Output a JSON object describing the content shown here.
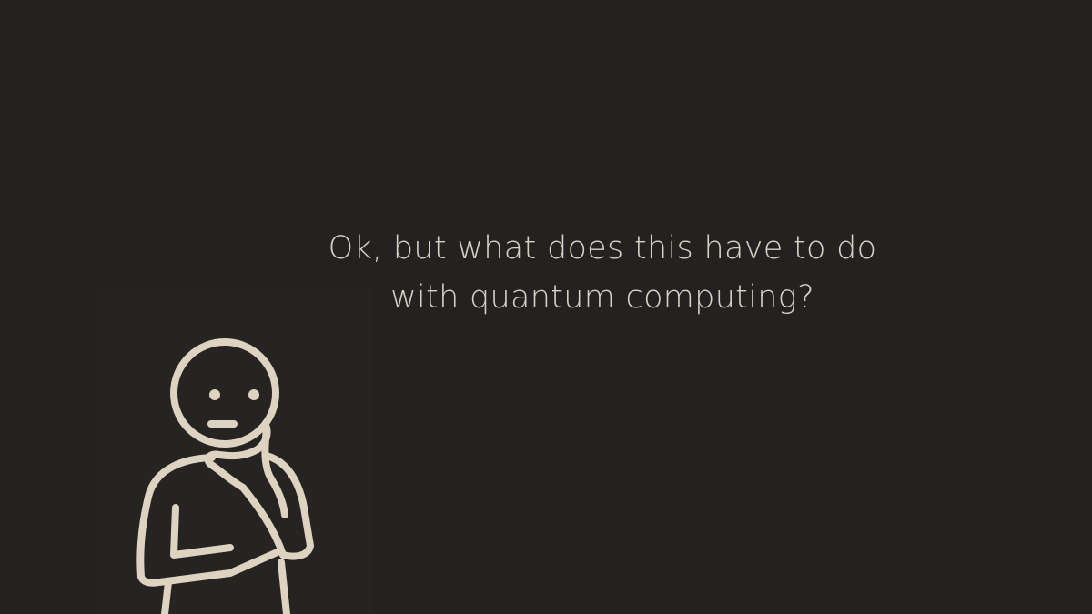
{
  "slide": {
    "caption_lines": [
      "Ok, but what does this have to do",
      "with quantum computing?"
    ]
  },
  "illustration": {
    "icon": "thinking-person-icon",
    "stroke_color": "#ddd3c0"
  },
  "colors": {
    "background": "#232220",
    "text": "#d8d2c6"
  }
}
